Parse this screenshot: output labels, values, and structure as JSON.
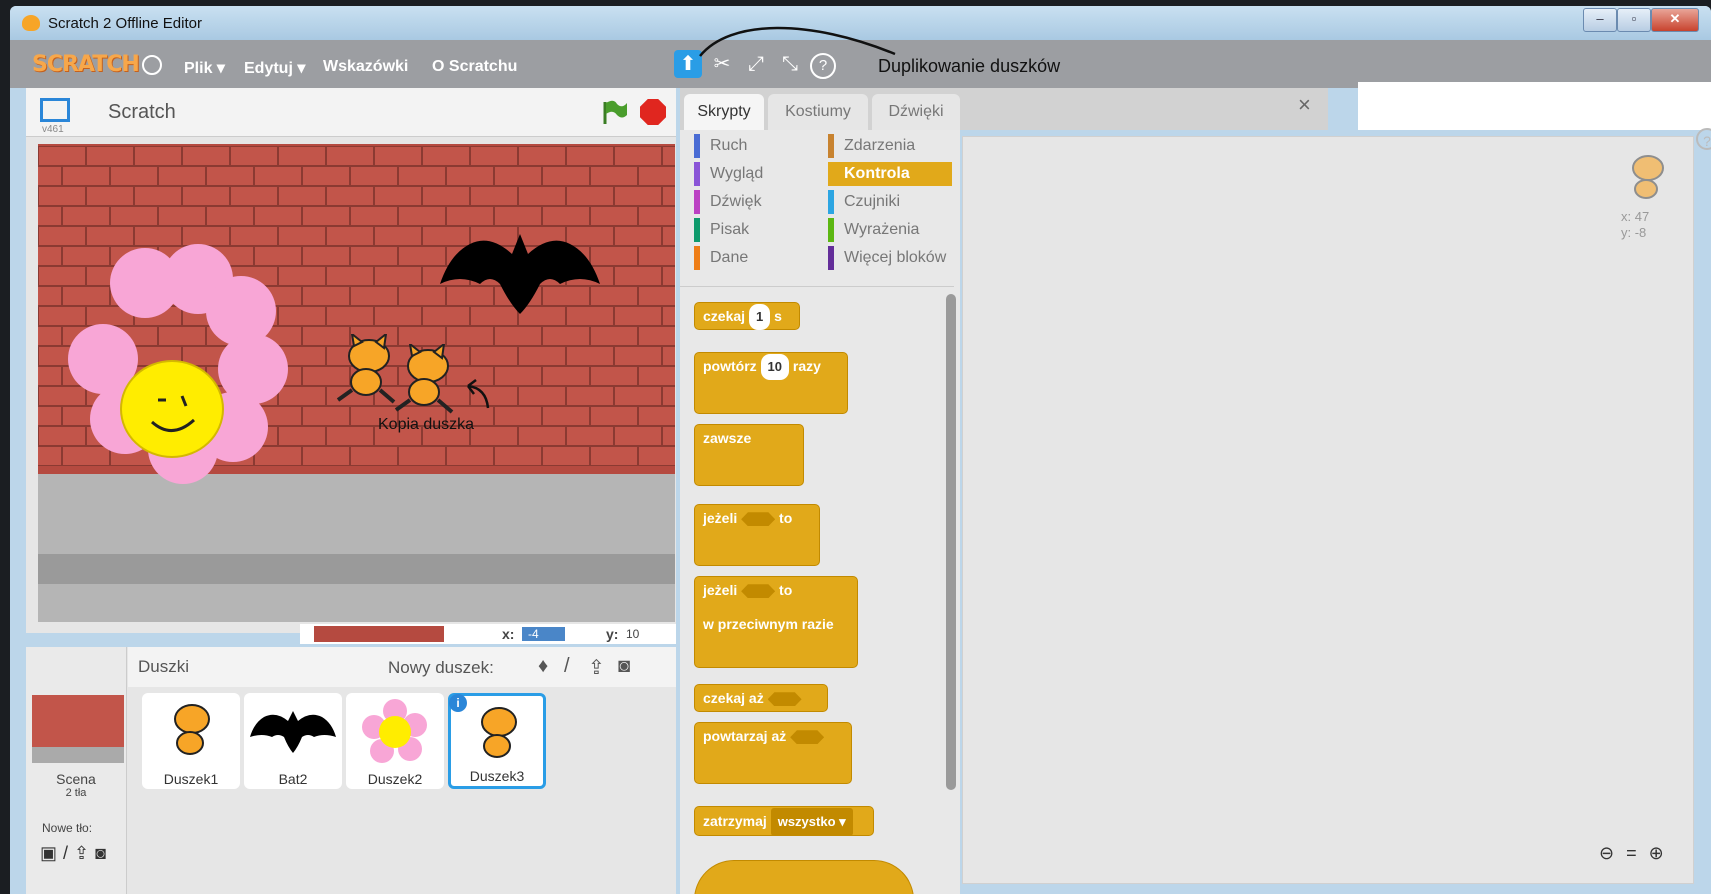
{
  "window": {
    "title": "Scratch 2 Offline Editor",
    "controls": [
      "–",
      "▫",
      "✕"
    ]
  },
  "menubar": {
    "logo": "SCRATCH",
    "items": [
      "Plik ▾",
      "Edytuj ▾",
      "Wskazówki",
      "O Scratchu"
    ],
    "tools": {
      "duplicate": "⬆",
      "delete": "✂",
      "grow": "⤢",
      "shrink": "⤡",
      "help": "?"
    },
    "annotation": "Duplikowanie duszków"
  },
  "stage": {
    "title": "Scratch",
    "version": "v461",
    "annotation": "Kopia duszka",
    "mouse_x_label": "x:",
    "mouse_x": "-4",
    "mouse_y_label": "y:",
    "mouse_y": "10"
  },
  "sprites": {
    "header": "Duszki",
    "new_sprite_label": "Nowy duszek:",
    "stage_label": "Scena",
    "stage_backdrops": "2 tła",
    "new_backdrop_label": "Nowe tło:",
    "items": [
      {
        "name": "Duszek1"
      },
      {
        "name": "Bat2"
      },
      {
        "name": "Duszek2"
      },
      {
        "name": "Duszek3",
        "selected": true
      }
    ]
  },
  "tabs": [
    "Skrypty",
    "Kostiumy",
    "Dźwięki"
  ],
  "categories": [
    {
      "label": "Ruch",
      "color": "#4a6cd4"
    },
    {
      "label": "Zdarzenia",
      "color": "#c88330"
    },
    {
      "label": "Wygląd",
      "color": "#8a55d7"
    },
    {
      "label": "Kontrola",
      "color": "#e1a91a"
    },
    {
      "label": "Dźwięk",
      "color": "#bb42c3"
    },
    {
      "label": "Czujniki",
      "color": "#2ca5e2"
    },
    {
      "label": "Pisak",
      "color": "#0e9a6c"
    },
    {
      "label": "Wyrażenia",
      "color": "#5cb712"
    },
    {
      "label": "Dane",
      "color": "#ee7d16"
    },
    {
      "label": "Więcej bloków",
      "color": "#632d99"
    }
  ],
  "blocks": {
    "wait": "czekaj",
    "wait_val": "1",
    "wait_unit": "s",
    "repeat": "powtórz",
    "repeat_val": "10",
    "repeat_unit": "razy",
    "forever": "zawsze",
    "if": "jeżeli",
    "then": "to",
    "else": "w przeciwnym razie",
    "wait_until": "czekaj aż",
    "repeat_until": "powtarzaj aż",
    "stop": "zatrzymaj",
    "stop_val": "wszystko ▾"
  },
  "scripts_area": {
    "sprite_x": "x: 47",
    "sprite_y": "y: -8"
  }
}
